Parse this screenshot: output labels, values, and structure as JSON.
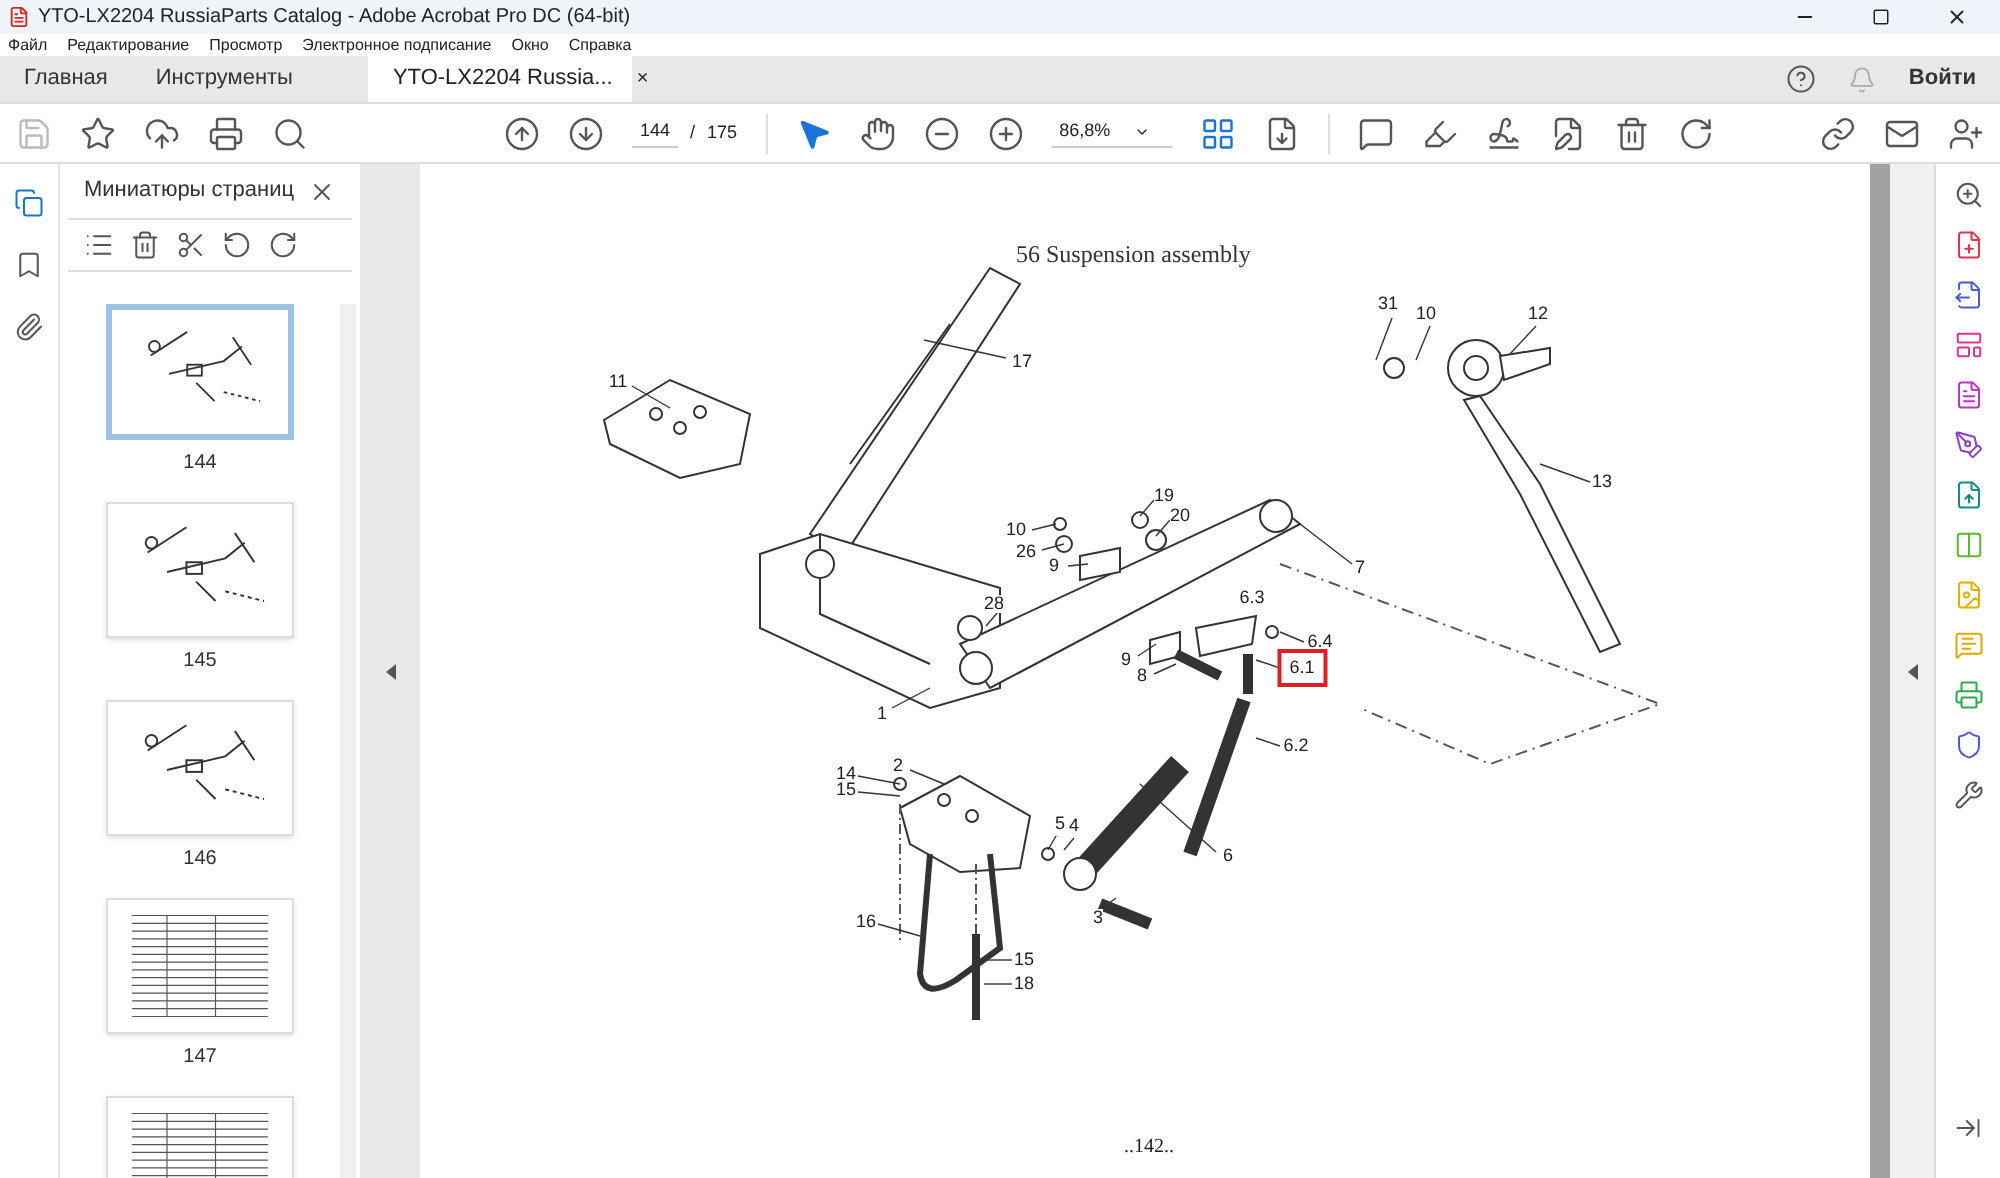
{
  "window": {
    "title": "YTO-LX2204 RussiaParts Catalog - Adobe Acrobat Pro DC (64-bit)"
  },
  "menu": [
    "Файл",
    "Редактирование",
    "Просмотр",
    "Электронное подписание",
    "Окно",
    "Справка"
  ],
  "tabs": [
    {
      "label": "Главная",
      "selected": false
    },
    {
      "label": "Инструменты",
      "selected": false
    },
    {
      "label": "YTO-LX2204 Russia...",
      "selected": true,
      "closable": true
    }
  ],
  "close_tab": "×",
  "sign_in": "Войти",
  "toolbar": {
    "page": "144",
    "separator": "/",
    "total": "175",
    "zoom": "86,8%"
  },
  "sidebar": {
    "title": "Миниатюры страниц",
    "thumbnails": [
      {
        "label": "144",
        "selected": true,
        "kind": "drawing"
      },
      {
        "label": "145",
        "selected": false,
        "kind": "drawing"
      },
      {
        "label": "146",
        "selected": false,
        "kind": "drawing"
      },
      {
        "label": "147",
        "selected": false,
        "kind": "table"
      },
      {
        "selected": false,
        "kind": "table"
      }
    ]
  },
  "document": {
    "title": "56 Suspension assembly",
    "footer": "..142..",
    "callouts": [
      {
        "label": "11",
        "highlighted": false
      },
      {
        "label": "17",
        "highlighted": false
      },
      {
        "label": "31",
        "highlighted": false
      },
      {
        "label": "10",
        "highlighted": false
      },
      {
        "label": "12",
        "highlighted": false
      },
      {
        "label": "13",
        "highlighted": false
      },
      {
        "label": "10",
        "highlighted": false
      },
      {
        "label": "26",
        "highlighted": false
      },
      {
        "label": "19",
        "highlighted": false
      },
      {
        "label": "20",
        "highlighted": false
      },
      {
        "label": "9",
        "highlighted": false
      },
      {
        "label": "7",
        "highlighted": false
      },
      {
        "label": "6.3",
        "highlighted": false
      },
      {
        "label": "28",
        "highlighted": false
      },
      {
        "label": "6.4",
        "highlighted": false
      },
      {
        "label": "9",
        "highlighted": false
      },
      {
        "label": "8",
        "highlighted": false
      },
      {
        "label": "6.1",
        "highlighted": true
      },
      {
        "label": "1",
        "highlighted": false
      },
      {
        "label": "6.2",
        "highlighted": false
      },
      {
        "label": "14",
        "highlighted": false
      },
      {
        "label": "2",
        "highlighted": false
      },
      {
        "label": "15",
        "highlighted": false
      },
      {
        "label": "5",
        "highlighted": false
      },
      {
        "label": "4",
        "highlighted": false
      },
      {
        "label": "6",
        "highlighted": false
      },
      {
        "label": "3",
        "highlighted": false
      },
      {
        "label": "16",
        "highlighted": false
      },
      {
        "label": "15",
        "highlighted": false
      },
      {
        "label": "18",
        "highlighted": false
      }
    ]
  }
}
